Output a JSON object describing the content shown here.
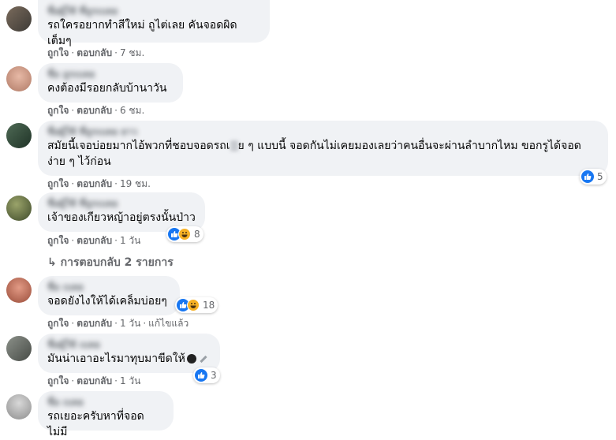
{
  "colors": {
    "bubble": "#f0f2f5",
    "like": "#1877f2",
    "haha": "#f7b125",
    "meta": "#65676b"
  },
  "comments": [
    {
      "name": "ชื่อผู้ใช้ ที่ถูกเบลอ",
      "text": "รถใครอยากทำสีใหม่ ถูไต่เลย คันจอดผิดเต็มๆ",
      "like": "ถูกใจ",
      "reply": "ตอบกลับ",
      "time": "7 ชม."
    },
    {
      "name": "ชื่อ ถูกเบลอ",
      "text": "คงต้องมีรอยกลับบ้านาวัน",
      "like": "ถูกใจ",
      "reply": "ตอบกลับ",
      "time": "6 ชม."
    },
    {
      "name": "ชื่อผู้ใช้ ที่ถูกเบลอ ยาว",
      "text_a": "สมัยนี้เจอบ่อยมากไอ้พวกที่ชอบจอดรถเ",
      "text_b": "ย ๆ แบบนี้ จอดกันไม่เคยมองเลยว่าคนอื่นจะผ่านลำบากไหม ขอกรูได้จอด",
      "text_c": "ง่าย ๆ ไว้ก่อน",
      "like": "ถูกใจ",
      "reply": "ตอบกลับ",
      "time": "19 ชม.",
      "reactions": "5"
    },
    {
      "name": "ชื่อผู้ใช้ ที่ถูกเบลอ",
      "text": "เจ้าของเกียวหญ้าอยู่ตรงนั้นป่าว",
      "like": "ถูกใจ",
      "reply": "ตอบกลับ",
      "time": "1 วัน",
      "reactions": "8",
      "replies": "การตอบกลับ 2 รายการ"
    },
    {
      "name": "ชื่อ เบลอ",
      "text": "จอดยังไงให้ได้เคล็มบ่อยๆ",
      "like": "ถูกใจ",
      "reply": "ตอบกลับ",
      "time": "1 วัน",
      "edited": "แก้ไขแล้ว",
      "reactions": "18"
    },
    {
      "name": "ชื่อผู้ใช้ เบลอ",
      "text": "มันน่าเอาอะไรมาทุบมาขีดให้",
      "like": "ถูกใจ",
      "reply": "ตอบกลับ",
      "time": "1 วัน",
      "reactions": "3"
    },
    {
      "name": "ชื่อ เบลอ",
      "text": "รถเยอะครับหาที่จอดไม่มี"
    }
  ]
}
